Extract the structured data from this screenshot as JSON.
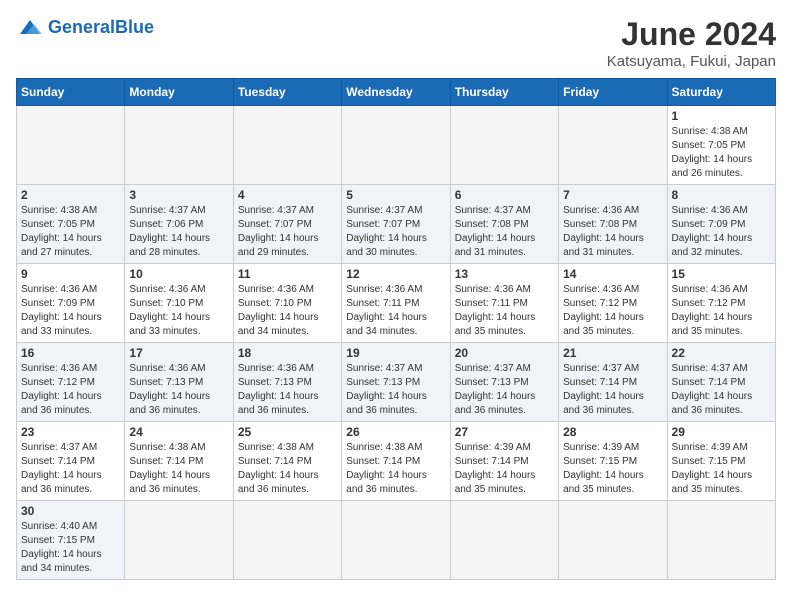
{
  "logo": {
    "general": "General",
    "blue": "Blue"
  },
  "title": "June 2024",
  "subtitle": "Katsuyama, Fukui, Japan",
  "days_header": [
    "Sunday",
    "Monday",
    "Tuesday",
    "Wednesday",
    "Thursday",
    "Friday",
    "Saturday"
  ],
  "weeks": [
    [
      {
        "day": "",
        "info": ""
      },
      {
        "day": "",
        "info": ""
      },
      {
        "day": "",
        "info": ""
      },
      {
        "day": "",
        "info": ""
      },
      {
        "day": "",
        "info": ""
      },
      {
        "day": "",
        "info": ""
      },
      {
        "day": "1",
        "info": "Sunrise: 4:38 AM\nSunset: 7:05 PM\nDaylight: 14 hours and 26 minutes."
      }
    ],
    [
      {
        "day": "2",
        "info": "Sunrise: 4:38 AM\nSunset: 7:05 PM\nDaylight: 14 hours and 27 minutes."
      },
      {
        "day": "3",
        "info": "Sunrise: 4:37 AM\nSunset: 7:06 PM\nDaylight: 14 hours and 28 minutes."
      },
      {
        "day": "4",
        "info": "Sunrise: 4:37 AM\nSunset: 7:07 PM\nDaylight: 14 hours and 29 minutes."
      },
      {
        "day": "5",
        "info": "Sunrise: 4:37 AM\nSunset: 7:07 PM\nDaylight: 14 hours and 30 minutes."
      },
      {
        "day": "6",
        "info": "Sunrise: 4:37 AM\nSunset: 7:08 PM\nDaylight: 14 hours and 31 minutes."
      },
      {
        "day": "7",
        "info": "Sunrise: 4:36 AM\nSunset: 7:08 PM\nDaylight: 14 hours and 31 minutes."
      },
      {
        "day": "8",
        "info": "Sunrise: 4:36 AM\nSunset: 7:09 PM\nDaylight: 14 hours and 32 minutes."
      }
    ],
    [
      {
        "day": "9",
        "info": "Sunrise: 4:36 AM\nSunset: 7:09 PM\nDaylight: 14 hours and 33 minutes."
      },
      {
        "day": "10",
        "info": "Sunrise: 4:36 AM\nSunset: 7:10 PM\nDaylight: 14 hours and 33 minutes."
      },
      {
        "day": "11",
        "info": "Sunrise: 4:36 AM\nSunset: 7:10 PM\nDaylight: 14 hours and 34 minutes."
      },
      {
        "day": "12",
        "info": "Sunrise: 4:36 AM\nSunset: 7:11 PM\nDaylight: 14 hours and 34 minutes."
      },
      {
        "day": "13",
        "info": "Sunrise: 4:36 AM\nSunset: 7:11 PM\nDaylight: 14 hours and 35 minutes."
      },
      {
        "day": "14",
        "info": "Sunrise: 4:36 AM\nSunset: 7:12 PM\nDaylight: 14 hours and 35 minutes."
      },
      {
        "day": "15",
        "info": "Sunrise: 4:36 AM\nSunset: 7:12 PM\nDaylight: 14 hours and 35 minutes."
      }
    ],
    [
      {
        "day": "16",
        "info": "Sunrise: 4:36 AM\nSunset: 7:12 PM\nDaylight: 14 hours and 36 minutes."
      },
      {
        "day": "17",
        "info": "Sunrise: 4:36 AM\nSunset: 7:13 PM\nDaylight: 14 hours and 36 minutes."
      },
      {
        "day": "18",
        "info": "Sunrise: 4:36 AM\nSunset: 7:13 PM\nDaylight: 14 hours and 36 minutes."
      },
      {
        "day": "19",
        "info": "Sunrise: 4:37 AM\nSunset: 7:13 PM\nDaylight: 14 hours and 36 minutes."
      },
      {
        "day": "20",
        "info": "Sunrise: 4:37 AM\nSunset: 7:13 PM\nDaylight: 14 hours and 36 minutes."
      },
      {
        "day": "21",
        "info": "Sunrise: 4:37 AM\nSunset: 7:14 PM\nDaylight: 14 hours and 36 minutes."
      },
      {
        "day": "22",
        "info": "Sunrise: 4:37 AM\nSunset: 7:14 PM\nDaylight: 14 hours and 36 minutes."
      }
    ],
    [
      {
        "day": "23",
        "info": "Sunrise: 4:37 AM\nSunset: 7:14 PM\nDaylight: 14 hours and 36 minutes."
      },
      {
        "day": "24",
        "info": "Sunrise: 4:38 AM\nSunset: 7:14 PM\nDaylight: 14 hours and 36 minutes."
      },
      {
        "day": "25",
        "info": "Sunrise: 4:38 AM\nSunset: 7:14 PM\nDaylight: 14 hours and 36 minutes."
      },
      {
        "day": "26",
        "info": "Sunrise: 4:38 AM\nSunset: 7:14 PM\nDaylight: 14 hours and 36 minutes."
      },
      {
        "day": "27",
        "info": "Sunrise: 4:39 AM\nSunset: 7:14 PM\nDaylight: 14 hours and 35 minutes."
      },
      {
        "day": "28",
        "info": "Sunrise: 4:39 AM\nSunset: 7:15 PM\nDaylight: 14 hours and 35 minutes."
      },
      {
        "day": "29",
        "info": "Sunrise: 4:39 AM\nSunset: 7:15 PM\nDaylight: 14 hours and 35 minutes."
      }
    ],
    [
      {
        "day": "30",
        "info": "Sunrise: 4:40 AM\nSunset: 7:15 PM\nDaylight: 14 hours and 34 minutes."
      },
      {
        "day": "",
        "info": ""
      },
      {
        "day": "",
        "info": ""
      },
      {
        "day": "",
        "info": ""
      },
      {
        "day": "",
        "info": ""
      },
      {
        "day": "",
        "info": ""
      },
      {
        "day": "",
        "info": ""
      }
    ]
  ]
}
